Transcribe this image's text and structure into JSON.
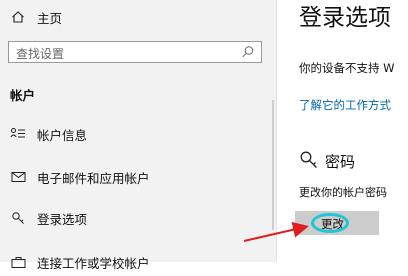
{
  "sidebar": {
    "home_label": "主页",
    "search_placeholder": "查找设置",
    "section_header": "帐户",
    "items": [
      {
        "label": "帐户信息"
      },
      {
        "label": "电子邮件和应用帐户"
      },
      {
        "label": "登录选项"
      },
      {
        "label": "连接工作或学校帐户"
      }
    ]
  },
  "content": {
    "page_title": "登录选项",
    "unsupported_text": "你的设备不支持 W",
    "learn_link": "了解它的工作方式",
    "password": {
      "heading": "密码",
      "description": "更改你的帐户密码",
      "button_label": "更改"
    }
  },
  "annotations": {
    "highlight_color": "#1fc6d8",
    "arrow_color": "#e02020"
  },
  "icons": {
    "home": "home-icon",
    "search": "search-icon",
    "account_info": "account-info-icon",
    "email": "mail-icon",
    "sign_in": "key-icon",
    "work_school": "briefcase-icon",
    "password": "key-icon"
  }
}
